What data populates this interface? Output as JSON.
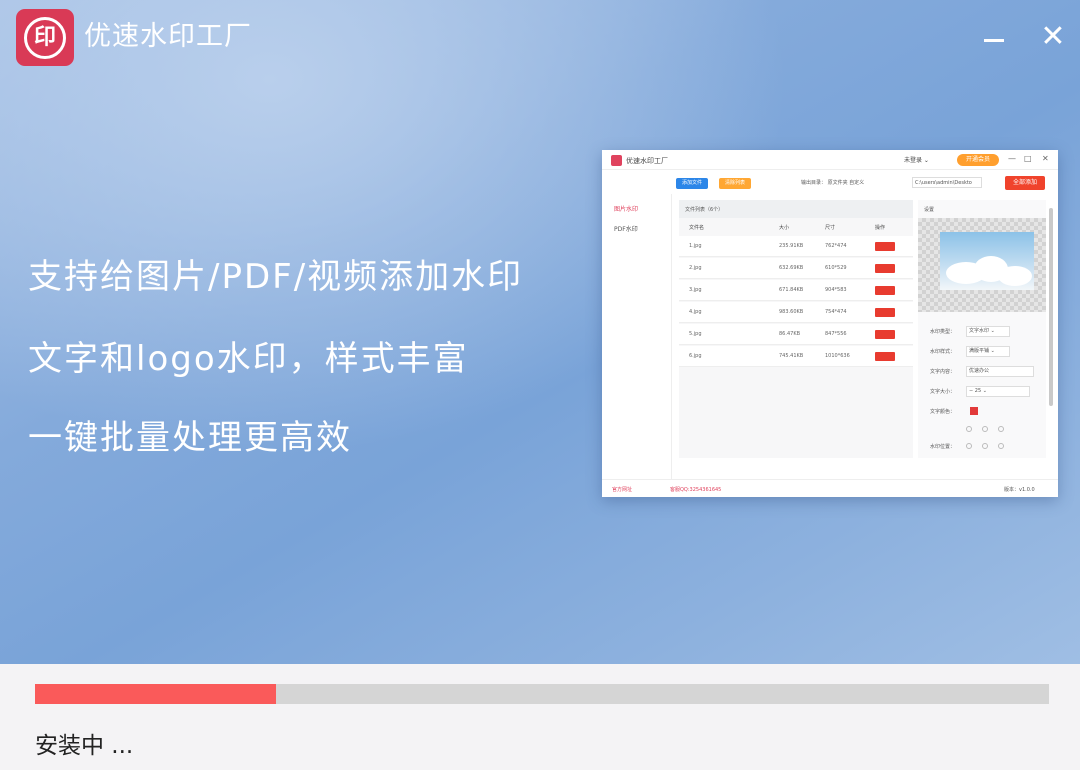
{
  "app": {
    "logo_char": "印",
    "title": "优速水印工厂"
  },
  "window_controls": {
    "close_symbol": "✕"
  },
  "features": [
    "支持给图片/PDF/视频添加水印",
    "文字和logo水印，样式丰富",
    "一键批量处理更高效"
  ],
  "preview": {
    "title": "优速水印工厂",
    "login": "未登录 ⌄",
    "upgrade": "开通会员",
    "add_file": "添加文件",
    "clear_list": "清除列表",
    "output_dir": "输出目录：  原文件夹   自定义",
    "path": "C:\\users\\admin\\Deskto",
    "start": "全部添加",
    "sidebar": [
      "图片水印",
      "PDF水印"
    ],
    "list_header": "文件列表（6个）",
    "columns": [
      "文件名",
      "大小",
      "尺寸",
      "操作"
    ],
    "rows": [
      {
        "name": "1.jpg",
        "size": "235.91KB",
        "dim": "762*474"
      },
      {
        "name": "2.jpg",
        "size": "632.69KB",
        "dim": "610*529"
      },
      {
        "name": "3.jpg",
        "size": "671.84KB",
        "dim": "904*583"
      },
      {
        "name": "4.jpg",
        "size": "983.60KB",
        "dim": "754*474"
      },
      {
        "name": "5.jpg",
        "size": "86.47KB",
        "dim": "847*556"
      },
      {
        "name": "6.jpg",
        "size": "745.41KB",
        "dim": "1010*636"
      }
    ],
    "settings_header": "设置",
    "settings": [
      {
        "label": "水印类型：",
        "value": "文字水印 ⌄"
      },
      {
        "label": "水印样式：",
        "value": "满版平铺 ⌄"
      },
      {
        "label": "文字内容：",
        "value": "优速办公"
      },
      {
        "label": "文字大小：",
        "value": "−   25   ⌄"
      },
      {
        "label": "文字颜色：",
        "value": ""
      },
      {
        "label": "水印位置：",
        "value": ""
      }
    ],
    "footer_left": "官方网址",
    "footer_mid": "客服QQ:3254361645",
    "footer_right": "版本：v1.0.0"
  },
  "install": {
    "progress": 0.238,
    "status": "安装中 ..."
  },
  "colors": {
    "brand": "#d93a56",
    "progress": "#fa5a5a",
    "track": "#d5d5d5"
  }
}
